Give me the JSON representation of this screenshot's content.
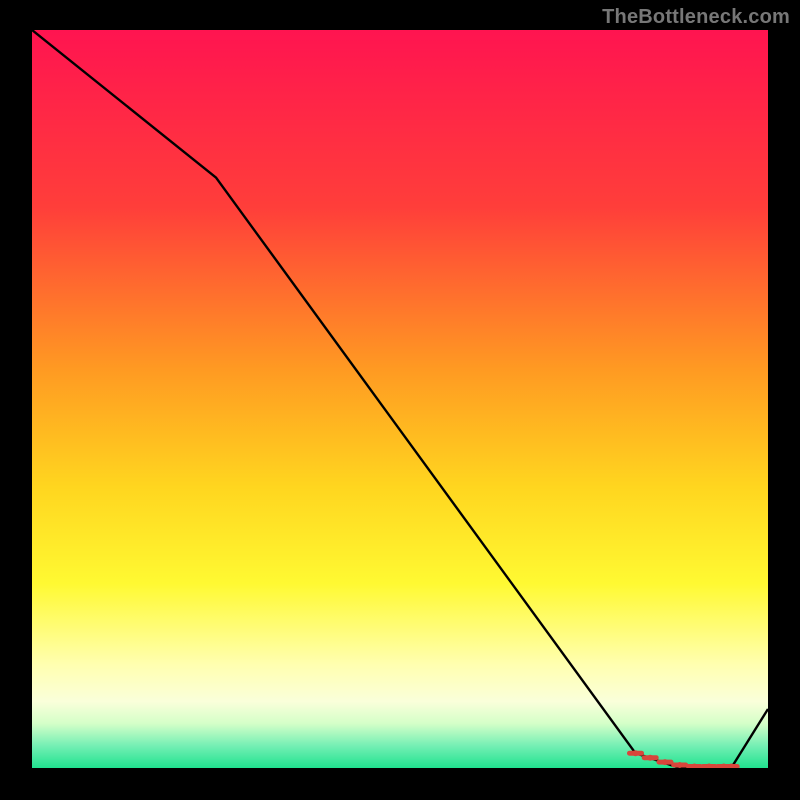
{
  "attribution": "TheBottleneck.com",
  "chart_data": {
    "type": "line",
    "title": "",
    "xlabel": "",
    "ylabel": "",
    "xlim": [
      0,
      100
    ],
    "ylim": [
      0,
      100
    ],
    "x": [
      0,
      25,
      82,
      88,
      95,
      100
    ],
    "values": [
      100,
      80,
      2,
      0,
      0,
      8
    ],
    "markers_x": [
      82,
      84,
      86,
      88,
      90,
      92,
      94,
      95
    ],
    "markers_y": [
      2,
      1.4,
      0.8,
      0.4,
      0.2,
      0.2,
      0.2,
      0.2
    ],
    "gradient_stops": [
      {
        "offset": 0,
        "color": "#ff1450"
      },
      {
        "offset": 24,
        "color": "#ff3e3a"
      },
      {
        "offset": 46,
        "color": "#ff9a22"
      },
      {
        "offset": 62,
        "color": "#ffd61f"
      },
      {
        "offset": 75,
        "color": "#fff932"
      },
      {
        "offset": 86,
        "color": "#ffffb0"
      },
      {
        "offset": 91,
        "color": "#faffda"
      },
      {
        "offset": 94,
        "color": "#d4ffc8"
      },
      {
        "offset": 97,
        "color": "#74efb4"
      },
      {
        "offset": 100,
        "color": "#20e28f"
      }
    ]
  }
}
